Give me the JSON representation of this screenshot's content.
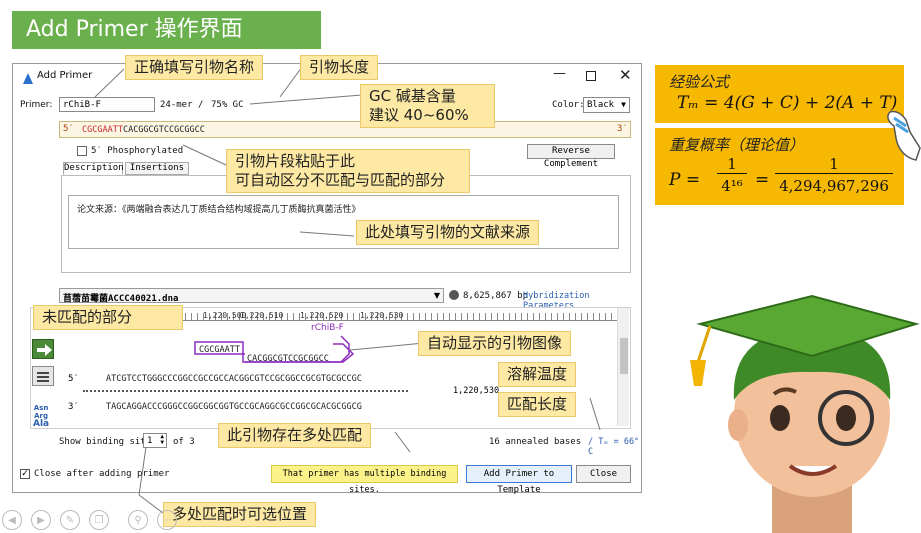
{
  "banner": {
    "title": "Add Primer 操作界面"
  },
  "dialog": {
    "title": "Add Primer",
    "primer_label": "Primer:",
    "primer_name": "rChiB-F",
    "length_info": "24-mer",
    "slash": "/",
    "gc_info": "75% GC",
    "color_label": "Color:",
    "color_value": "Black",
    "five_prime": "5′",
    "three_prime": "3′",
    "seq_mismatch": "CGCGAATT",
    "seq_match": "CACGGCGTCCGCGGCC",
    "phosphorylated": "5′ Phosphorylated",
    "reverse_complement": "Reverse Complement",
    "tab_description": "Description",
    "tab_insertions": "Insertions",
    "description_text": "论文来源：《两端融合表达几丁质结合结构域提高几丁质酶抗真菌活性》",
    "template_name": "苜蓿苗霉菌ACCC40021.dna",
    "template_bp": "8,625,867 bp",
    "hybrid_params": "Hybridization Parameters",
    "ruler_ticks": [
      "1,220,500",
      "1,220,510",
      "1,220,520",
      "1,220,530"
    ],
    "ruler_end_tick": "1,220,500",
    "primer_tag": "rChiB-F",
    "primer_box_mismatch": "CGCGAATT",
    "primer_box_match": "CACGGCGTCCGCGGCC",
    "top_strand_label": "5′",
    "top_strand": "ATCGTCCTGGGCCCGGCCGCCGCCACGGCGTCCGCGGCCGCGTGCGCCGC",
    "bottom_strand_label": "3′",
    "bottom_strand": "TAGCAGGACCCGGGCCGGCGGCGGTGCCGCAGGCGCCGGCGCACGCGGCG",
    "position_label": "1,220,530",
    "side_tool_labels": [
      "Asn",
      "Arg",
      "Ala"
    ],
    "show_binding_label": "Show binding site",
    "binding_site_value": "1",
    "binding_site_total": "of 3",
    "annealed_info": "16 annealed bases",
    "tm_info": "/ Tₘ = 66° C",
    "close_after_label": "Close after adding primer",
    "warning_text": "That primer has multiple binding sites.",
    "add_button": "Add Primer to Template",
    "close_button": "Close"
  },
  "callouts": {
    "name": "正确填写引物名称",
    "length": "引物长度",
    "gc_line1": "GC 碱基含量",
    "gc_line2": "建议 40~60%",
    "paste_line1": "引物片段粘贴于此",
    "paste_line2": "可自动区分不匹配与匹配的部分",
    "source": "此处填写引物的文献来源",
    "mismatch": "未匹配的部分",
    "image": "自动显示的引物图像",
    "tm": "溶解温度",
    "match_len": "匹配长度",
    "multi": "此引物存在多处匹配",
    "select_pos": "多处匹配时可选位置"
  },
  "formulas": {
    "empirical_title": "经验公式",
    "tm_formula": "Tₘ = 4(G + C) + 2(A + T)",
    "repeat_title": "重复概率（理论值）",
    "p_lhs": "P =",
    "p_num1": "1",
    "p_den1": "4¹⁶",
    "p_eq": "=",
    "p_num2": "1",
    "p_den2": "4,294,967,296"
  },
  "colors": {
    "banner_green": "#6ab04c",
    "callout_yellow": "#fde9a4",
    "formula_orange": "#f6b800",
    "mismatch_red": "#d0282f",
    "primer_purple": "#8e2bbf",
    "link_blue": "#2a5db0"
  }
}
